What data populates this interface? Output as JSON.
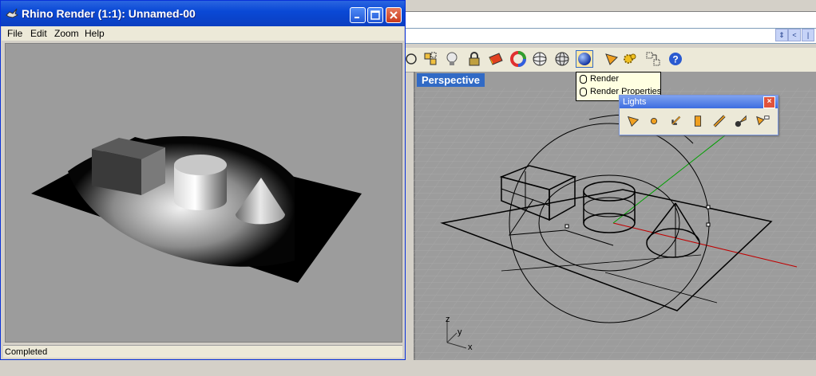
{
  "render_window": {
    "title": "Rhino Render (1:1): Unnamed-00",
    "menu": [
      "File",
      "Edit",
      "Zoom",
      "Help"
    ],
    "status": "Completed"
  },
  "viewport": {
    "title": "Perspective",
    "axis_labels": {
      "x": "x",
      "y": "y",
      "z": "z"
    }
  },
  "render_flyout": {
    "items": [
      "Render",
      "Render Properties"
    ]
  },
  "lights_toolbar": {
    "title": "Lights",
    "close": "×",
    "icons": [
      "spotlight-icon",
      "point-light-icon",
      "directional-light-icon",
      "rectangular-light-icon",
      "linear-light-icon",
      "light-object-icon",
      "edit-light-icon"
    ]
  },
  "main_toolbar": {
    "icons": [
      "rotate-icon",
      "snap-icon",
      "light-bulb-icon",
      "lock-icon",
      "material-icon",
      "color-wheel-icon",
      "sphere-wireframe-icon",
      "sphere-shaded-icon",
      "render-icon",
      "spotlight-icon",
      "gears-icon",
      "layout-icon",
      "help-icon"
    ]
  },
  "colors": {
    "titlebar": "#0a49d6",
    "viewport_bg": "#9c9c9c",
    "active_viewport_title": "#316ac5",
    "x_axis": "#c00000",
    "y_axis": "#00a000"
  }
}
